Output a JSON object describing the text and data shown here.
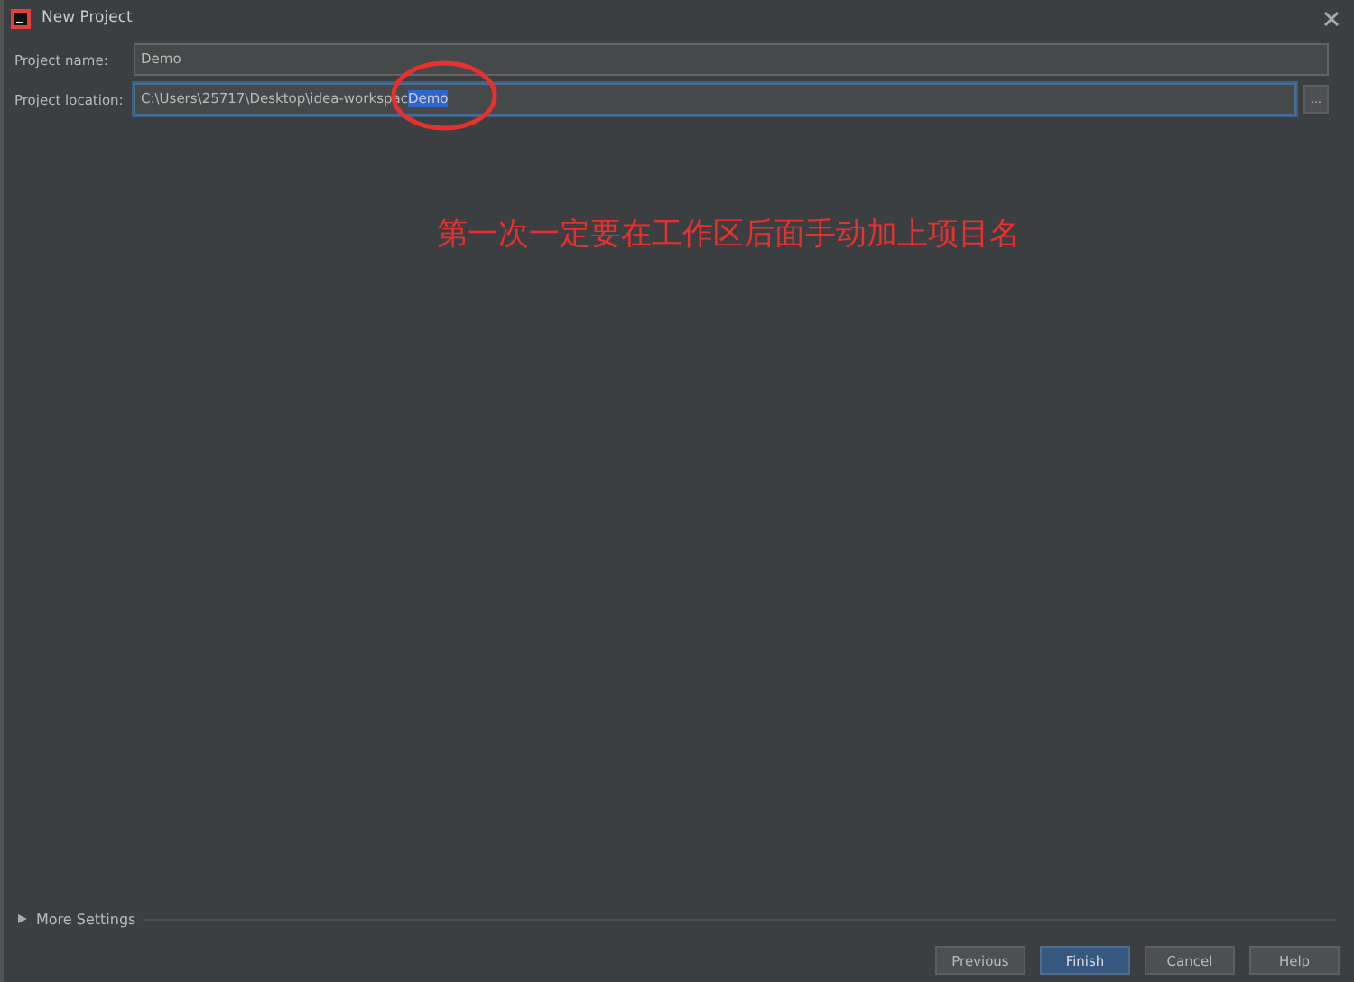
{
  "window": {
    "title": "New Project"
  },
  "fields": [
    {
      "label": "Project name:",
      "value": "Demo",
      "focused": false
    },
    {
      "label": "Project location:",
      "value": "C:\\Users\\25717\\Desktop\\idea-workspac",
      "selected_text": "Demo",
      "focused": true,
      "browse": "..."
    }
  ],
  "annotation": {
    "text": "第一次一定要在工作区后面手动加上项目名"
  },
  "more_settings": {
    "label": "More Settings",
    "expanded": false
  },
  "buttons": [
    {
      "label": "Previous",
      "default": false
    },
    {
      "label": "Finish",
      "default": true
    },
    {
      "label": "Cancel",
      "default": false
    },
    {
      "label": "Help",
      "default": false
    }
  ]
}
